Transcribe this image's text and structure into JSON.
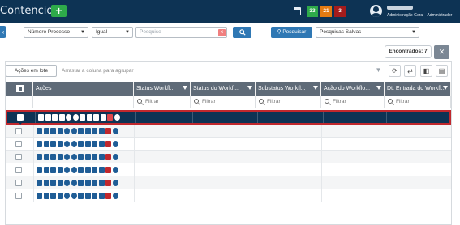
{
  "app": {
    "title": "Contencioso",
    "add_label": "+",
    "badges": [
      "33",
      "21",
      "3"
    ],
    "user_role": "Administração Geral - Administrador"
  },
  "search": {
    "field": "Número Processo",
    "operator": "Igual",
    "placeholder": "Pesquise",
    "clear_label": "x",
    "search_button": "Pesquisar",
    "saved": "Pesquisas Salvas"
  },
  "results": {
    "found_label": "Encontrados: 7"
  },
  "toolbar": {
    "batch_label": "Ações em lote",
    "drag_hint": "Arrastar a coluna para agrupar"
  },
  "grid": {
    "columns": [
      "Ações",
      "Status Workfl...",
      "Status do Workfl...",
      "Substatus Workfl...",
      "Ação do Workflo...",
      "Dt. Entrada do Workfl..."
    ],
    "filter_placeholder": "Filtrar",
    "row_count": 7,
    "selected_row": 1
  },
  "colors": {
    "header_bg": "#0d3354",
    "accent": "#2f78b4",
    "green": "#2eaa4a",
    "badge1": "#2eaa4a",
    "badge2": "#e37b12",
    "badge3": "#a51c1c",
    "grid_header": "#5f6b78",
    "selected_border": "#c0282d"
  },
  "icons": [
    "list-icon",
    "table-icon",
    "calendar-icon",
    "document-icon",
    "person-icon",
    "clock-icon",
    "cloud-icon",
    "money-icon",
    "calculator-icon",
    "share-icon",
    "trash-icon",
    "star-icon"
  ]
}
